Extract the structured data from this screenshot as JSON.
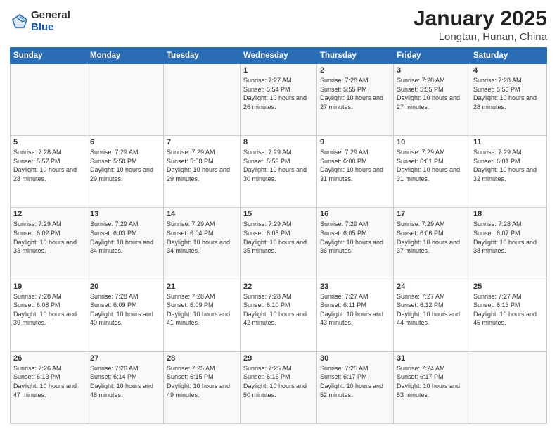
{
  "logo": {
    "general": "General",
    "blue": "Blue"
  },
  "title": "January 2025",
  "subtitle": "Longtan, Hunan, China",
  "weekdays": [
    "Sunday",
    "Monday",
    "Tuesday",
    "Wednesday",
    "Thursday",
    "Friday",
    "Saturday"
  ],
  "weeks": [
    [
      {
        "day": "",
        "sunrise": "",
        "sunset": "",
        "daylight": ""
      },
      {
        "day": "",
        "sunrise": "",
        "sunset": "",
        "daylight": ""
      },
      {
        "day": "",
        "sunrise": "",
        "sunset": "",
        "daylight": ""
      },
      {
        "day": "1",
        "sunrise": "Sunrise: 7:27 AM",
        "sunset": "Sunset: 5:54 PM",
        "daylight": "Daylight: 10 hours and 26 minutes."
      },
      {
        "day": "2",
        "sunrise": "Sunrise: 7:28 AM",
        "sunset": "Sunset: 5:55 PM",
        "daylight": "Daylight: 10 hours and 27 minutes."
      },
      {
        "day": "3",
        "sunrise": "Sunrise: 7:28 AM",
        "sunset": "Sunset: 5:55 PM",
        "daylight": "Daylight: 10 hours and 27 minutes."
      },
      {
        "day": "4",
        "sunrise": "Sunrise: 7:28 AM",
        "sunset": "Sunset: 5:56 PM",
        "daylight": "Daylight: 10 hours and 28 minutes."
      }
    ],
    [
      {
        "day": "5",
        "sunrise": "Sunrise: 7:28 AM",
        "sunset": "Sunset: 5:57 PM",
        "daylight": "Daylight: 10 hours and 28 minutes."
      },
      {
        "day": "6",
        "sunrise": "Sunrise: 7:29 AM",
        "sunset": "Sunset: 5:58 PM",
        "daylight": "Daylight: 10 hours and 29 minutes."
      },
      {
        "day": "7",
        "sunrise": "Sunrise: 7:29 AM",
        "sunset": "Sunset: 5:58 PM",
        "daylight": "Daylight: 10 hours and 29 minutes."
      },
      {
        "day": "8",
        "sunrise": "Sunrise: 7:29 AM",
        "sunset": "Sunset: 5:59 PM",
        "daylight": "Daylight: 10 hours and 30 minutes."
      },
      {
        "day": "9",
        "sunrise": "Sunrise: 7:29 AM",
        "sunset": "Sunset: 6:00 PM",
        "daylight": "Daylight: 10 hours and 31 minutes."
      },
      {
        "day": "10",
        "sunrise": "Sunrise: 7:29 AM",
        "sunset": "Sunset: 6:01 PM",
        "daylight": "Daylight: 10 hours and 31 minutes."
      },
      {
        "day": "11",
        "sunrise": "Sunrise: 7:29 AM",
        "sunset": "Sunset: 6:01 PM",
        "daylight": "Daylight: 10 hours and 32 minutes."
      }
    ],
    [
      {
        "day": "12",
        "sunrise": "Sunrise: 7:29 AM",
        "sunset": "Sunset: 6:02 PM",
        "daylight": "Daylight: 10 hours and 33 minutes."
      },
      {
        "day": "13",
        "sunrise": "Sunrise: 7:29 AM",
        "sunset": "Sunset: 6:03 PM",
        "daylight": "Daylight: 10 hours and 34 minutes."
      },
      {
        "day": "14",
        "sunrise": "Sunrise: 7:29 AM",
        "sunset": "Sunset: 6:04 PM",
        "daylight": "Daylight: 10 hours and 34 minutes."
      },
      {
        "day": "15",
        "sunrise": "Sunrise: 7:29 AM",
        "sunset": "Sunset: 6:05 PM",
        "daylight": "Daylight: 10 hours and 35 minutes."
      },
      {
        "day": "16",
        "sunrise": "Sunrise: 7:29 AM",
        "sunset": "Sunset: 6:05 PM",
        "daylight": "Daylight: 10 hours and 36 minutes."
      },
      {
        "day": "17",
        "sunrise": "Sunrise: 7:29 AM",
        "sunset": "Sunset: 6:06 PM",
        "daylight": "Daylight: 10 hours and 37 minutes."
      },
      {
        "day": "18",
        "sunrise": "Sunrise: 7:28 AM",
        "sunset": "Sunset: 6:07 PM",
        "daylight": "Daylight: 10 hours and 38 minutes."
      }
    ],
    [
      {
        "day": "19",
        "sunrise": "Sunrise: 7:28 AM",
        "sunset": "Sunset: 6:08 PM",
        "daylight": "Daylight: 10 hours and 39 minutes."
      },
      {
        "day": "20",
        "sunrise": "Sunrise: 7:28 AM",
        "sunset": "Sunset: 6:09 PM",
        "daylight": "Daylight: 10 hours and 40 minutes."
      },
      {
        "day": "21",
        "sunrise": "Sunrise: 7:28 AM",
        "sunset": "Sunset: 6:09 PM",
        "daylight": "Daylight: 10 hours and 41 minutes."
      },
      {
        "day": "22",
        "sunrise": "Sunrise: 7:28 AM",
        "sunset": "Sunset: 6:10 PM",
        "daylight": "Daylight: 10 hours and 42 minutes."
      },
      {
        "day": "23",
        "sunrise": "Sunrise: 7:27 AM",
        "sunset": "Sunset: 6:11 PM",
        "daylight": "Daylight: 10 hours and 43 minutes."
      },
      {
        "day": "24",
        "sunrise": "Sunrise: 7:27 AM",
        "sunset": "Sunset: 6:12 PM",
        "daylight": "Daylight: 10 hours and 44 minutes."
      },
      {
        "day": "25",
        "sunrise": "Sunrise: 7:27 AM",
        "sunset": "Sunset: 6:13 PM",
        "daylight": "Daylight: 10 hours and 45 minutes."
      }
    ],
    [
      {
        "day": "26",
        "sunrise": "Sunrise: 7:26 AM",
        "sunset": "Sunset: 6:13 PM",
        "daylight": "Daylight: 10 hours and 47 minutes."
      },
      {
        "day": "27",
        "sunrise": "Sunrise: 7:26 AM",
        "sunset": "Sunset: 6:14 PM",
        "daylight": "Daylight: 10 hours and 48 minutes."
      },
      {
        "day": "28",
        "sunrise": "Sunrise: 7:25 AM",
        "sunset": "Sunset: 6:15 PM",
        "daylight": "Daylight: 10 hours and 49 minutes."
      },
      {
        "day": "29",
        "sunrise": "Sunrise: 7:25 AM",
        "sunset": "Sunset: 6:16 PM",
        "daylight": "Daylight: 10 hours and 50 minutes."
      },
      {
        "day": "30",
        "sunrise": "Sunrise: 7:25 AM",
        "sunset": "Sunset: 6:17 PM",
        "daylight": "Daylight: 10 hours and 52 minutes."
      },
      {
        "day": "31",
        "sunrise": "Sunrise: 7:24 AM",
        "sunset": "Sunset: 6:17 PM",
        "daylight": "Daylight: 10 hours and 53 minutes."
      },
      {
        "day": "",
        "sunrise": "",
        "sunset": "",
        "daylight": ""
      }
    ]
  ]
}
